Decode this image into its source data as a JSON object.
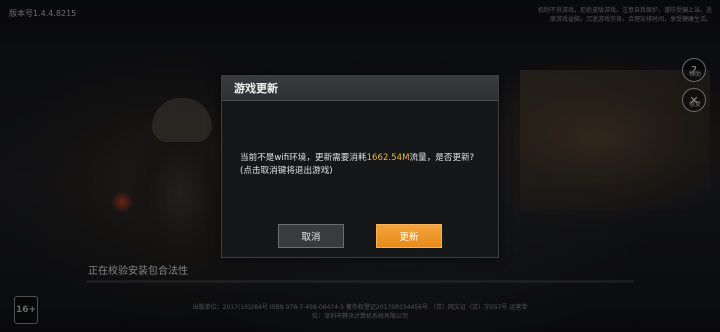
{
  "version_label": "版本号1.4.4.8215",
  "top_right_notice": "抵制不良游戏，拒绝盗版游戏。注意自我保护，谨防受骗上当。适度游戏益脑，沉迷游戏伤身。合理安排时间，享受健康生活。",
  "side_buttons": {
    "help_label": "帮助",
    "repair_label": "修复"
  },
  "verify": {
    "status_text": "正在校验安装包合法性",
    "progress": 0.0
  },
  "footer_text": "出版单位：2017(10)284号 ISBN 978-7-498-06474-5 著作权登记2017SR154456号 （京）网文证（京）字057号 运营单位：深圳市腾讯计算机系统有限公司",
  "age_badge": "16+",
  "dialog": {
    "title": "游戏更新",
    "message_prefix": "当前不是wifi环境，更新需要消耗",
    "highlight_size": "1662.54M",
    "message_suffix": "流量，是否更新?(点击取消键将退出游戏)",
    "cancel_label": "取消",
    "update_label": "更新"
  },
  "colors": {
    "accent_orange": "#ee951f",
    "highlight_text": "#e8b343",
    "dialog_bg": "#16171a"
  }
}
